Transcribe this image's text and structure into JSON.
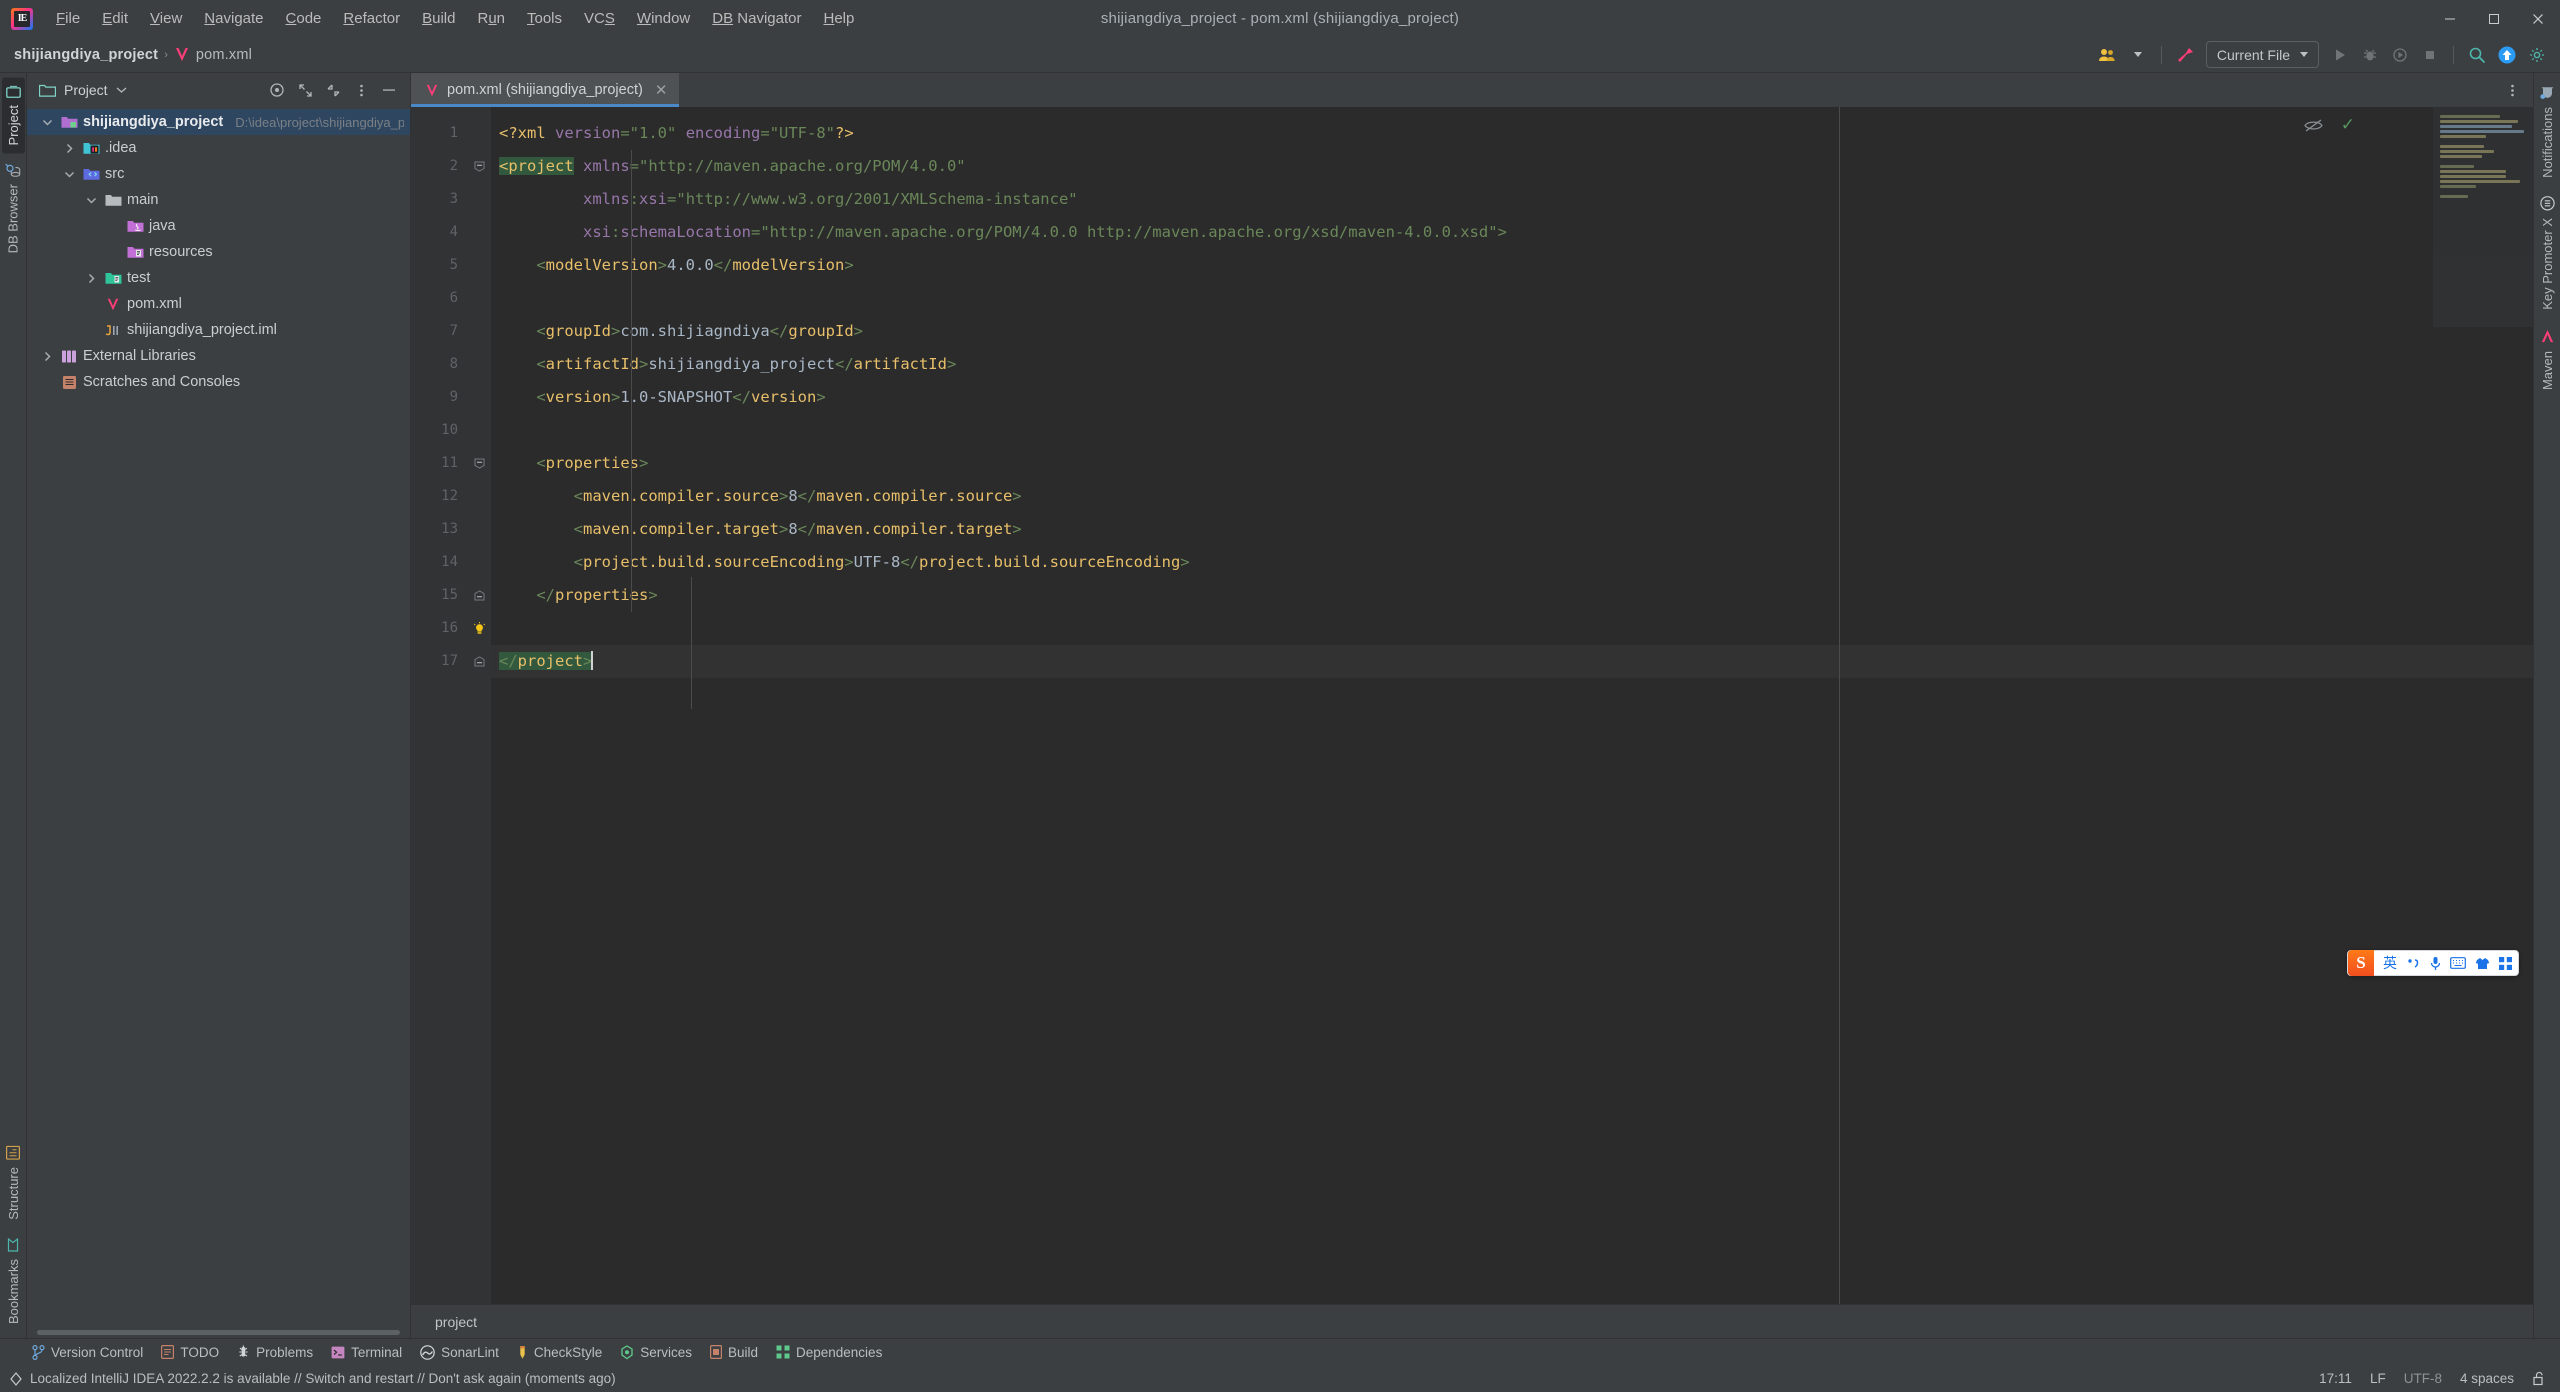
{
  "window": {
    "title": "shijiangdiya_project - pom.xml (shijiangdiya_project)",
    "logo_text": "IE",
    "minimize": "—",
    "maximize": "☐",
    "close": "✕"
  },
  "menu": {
    "items": [
      {
        "pre": "",
        "mn": "F",
        "post": "ile"
      },
      {
        "pre": "",
        "mn": "E",
        "post": "dit"
      },
      {
        "pre": "",
        "mn": "V",
        "post": "iew"
      },
      {
        "pre": "",
        "mn": "N",
        "post": "avigate"
      },
      {
        "pre": "",
        "mn": "C",
        "post": "ode"
      },
      {
        "pre": "",
        "mn": "R",
        "post": "efactor"
      },
      {
        "pre": "",
        "mn": "B",
        "post": "uild"
      },
      {
        "pre": "R",
        "mn": "u",
        "post": "n"
      },
      {
        "pre": "",
        "mn": "T",
        "post": "ools"
      },
      {
        "pre": "VC",
        "mn": "S",
        "post": ""
      },
      {
        "pre": "",
        "mn": "W",
        "post": "indow"
      },
      {
        "pre": "",
        "mn": "DB",
        "post": " Navigator"
      },
      {
        "pre": "",
        "mn": "H",
        "post": "elp"
      }
    ]
  },
  "navbar": {
    "crumbs": [
      "shijiangdiya_project",
      "pom.xml"
    ],
    "separator": "›",
    "run_config": "Current File",
    "icons": [
      "people-icon",
      "hammer-icon",
      "run-icon",
      "debug-icon",
      "run-coverage-icon",
      "stop-icon",
      "search-icon",
      "update-icon",
      "settings-icon"
    ]
  },
  "left_strip": {
    "top": [
      {
        "label": "Project",
        "icon": "project-icon",
        "active": true
      },
      {
        "label": "DB Browser",
        "icon": "db-browser-icon",
        "active": false
      }
    ],
    "bottom": [
      {
        "label": "Structure",
        "icon": "structure-icon"
      },
      {
        "label": "Bookmarks",
        "icon": "bookmarks-icon"
      }
    ]
  },
  "right_strip": {
    "items": [
      {
        "label": "Notifications",
        "icon": "notifications-icon"
      },
      {
        "label": "Key Promoter X",
        "icon": "key-promoter-icon"
      },
      {
        "label": "Maven",
        "icon": "maven-icon"
      }
    ]
  },
  "project_panel": {
    "title": "Project",
    "header_icons": [
      "target-icon",
      "expand-icon",
      "collapse-icon",
      "more-icon",
      "hide-icon"
    ],
    "tree": [
      {
        "indent": 0,
        "arrow": "down",
        "icon": "module-folder",
        "label": "shijiangdiya_project",
        "path": "D:\\idea\\project\\shijiangdiya_project",
        "selected": true,
        "bold": true
      },
      {
        "indent": 1,
        "arrow": "right",
        "icon": "idea-folder",
        "label": ".idea",
        "path": "",
        "selected": false,
        "bold": false
      },
      {
        "indent": 1,
        "arrow": "down",
        "icon": "src-folder",
        "label": "src",
        "path": "",
        "selected": false,
        "bold": false
      },
      {
        "indent": 2,
        "arrow": "down",
        "icon": "plain-folder",
        "label": "main",
        "path": "",
        "selected": false,
        "bold": false
      },
      {
        "indent": 3,
        "arrow": "none",
        "icon": "java-folder",
        "label": "java",
        "path": "",
        "selected": false,
        "bold": false
      },
      {
        "indent": 3,
        "arrow": "none",
        "icon": "resources-folder",
        "label": "resources",
        "path": "",
        "selected": false,
        "bold": false
      },
      {
        "indent": 2,
        "arrow": "right",
        "icon": "test-folder",
        "label": "test",
        "path": "",
        "selected": false,
        "bold": false
      },
      {
        "indent": 2,
        "arrow": "none",
        "icon": "maven-file",
        "label": "pom.xml",
        "path": "",
        "selected": false,
        "bold": false
      },
      {
        "indent": 2,
        "arrow": "none",
        "icon": "iml-file",
        "label": "shijiangdiya_project.iml",
        "path": "",
        "selected": false,
        "bold": false
      },
      {
        "indent": 0,
        "arrow": "right",
        "icon": "libraries-icon",
        "label": "External Libraries",
        "path": "",
        "selected": false,
        "bold": false
      },
      {
        "indent": 0,
        "arrow": "none",
        "icon": "scratches-icon",
        "label": "Scratches and Consoles",
        "path": "",
        "selected": false,
        "bold": false
      }
    ]
  },
  "editor": {
    "tab": {
      "label": "pom.xml (shijiangdiya_project)",
      "icon": "maven-icon",
      "close": "✕"
    },
    "breadcrumb_status": "project",
    "inspection_ok": "✓",
    "reader_mode_icon": "eye-off-icon",
    "lines": [
      {
        "n": 1,
        "fold": "",
        "tokens": [
          {
            "t": "<?xml ",
            "c": "proc"
          },
          {
            "t": "version",
            "c": "attr"
          },
          {
            "t": "=",
            "c": "tagb"
          },
          {
            "t": "\"1.0\"",
            "c": "str"
          },
          {
            "t": " ",
            "c": "txt"
          },
          {
            "t": "encoding",
            "c": "attr"
          },
          {
            "t": "=",
            "c": "tagb"
          },
          {
            "t": "\"UTF-8\"",
            "c": "str"
          },
          {
            "t": "?>",
            "c": "proc"
          }
        ]
      },
      {
        "n": 2,
        "fold": "minus",
        "tokens": [
          {
            "t": "<project",
            "c": "tagn hl"
          },
          {
            "t": " ",
            "c": "txt"
          },
          {
            "t": "xmlns",
            "c": "attr"
          },
          {
            "t": "=",
            "c": "tagb"
          },
          {
            "t": "\"http://maven.apache.org/POM/4.0.0\"",
            "c": "str"
          }
        ]
      },
      {
        "n": 3,
        "fold": "",
        "tokens": [
          {
            "t": "         ",
            "c": "txt"
          },
          {
            "t": "xmlns",
            "c": "attr"
          },
          {
            "t": ":",
            "c": "tagb"
          },
          {
            "t": "xsi",
            "c": "attr"
          },
          {
            "t": "=",
            "c": "tagb"
          },
          {
            "t": "\"http://www.w3.org/2001/XMLSchema-instance\"",
            "c": "str"
          }
        ]
      },
      {
        "n": 4,
        "fold": "",
        "tokens": [
          {
            "t": "         ",
            "c": "txt"
          },
          {
            "t": "xsi",
            "c": "attr"
          },
          {
            "t": ":",
            "c": "tagb"
          },
          {
            "t": "schemaLocation",
            "c": "attr"
          },
          {
            "t": "=",
            "c": "tagb"
          },
          {
            "t": "\"http://maven.apache.org/POM/4.0.0 http://maven.apache.org/xsd/maven-4.0.0.xsd\"",
            "c": "str"
          },
          {
            "t": ">",
            "c": "tagb"
          }
        ]
      },
      {
        "n": 5,
        "fold": "",
        "tokens": [
          {
            "t": "    <",
            "c": "tagb"
          },
          {
            "t": "modelVersion",
            "c": "tagn"
          },
          {
            "t": ">",
            "c": "tagb"
          },
          {
            "t": "4.0.0",
            "c": "txt"
          },
          {
            "t": "</",
            "c": "tagb"
          },
          {
            "t": "modelVersion",
            "c": "tagn"
          },
          {
            "t": ">",
            "c": "tagb"
          }
        ]
      },
      {
        "n": 6,
        "fold": "",
        "tokens": []
      },
      {
        "n": 7,
        "fold": "",
        "tokens": [
          {
            "t": "    <",
            "c": "tagb"
          },
          {
            "t": "groupId",
            "c": "tagn"
          },
          {
            "t": ">",
            "c": "tagb"
          },
          {
            "t": "com.shijiagndiya",
            "c": "txt"
          },
          {
            "t": "</",
            "c": "tagb"
          },
          {
            "t": "groupId",
            "c": "tagn"
          },
          {
            "t": ">",
            "c": "tagb"
          }
        ]
      },
      {
        "n": 8,
        "fold": "",
        "tokens": [
          {
            "t": "    <",
            "c": "tagb"
          },
          {
            "t": "artifactId",
            "c": "tagn"
          },
          {
            "t": ">",
            "c": "tagb"
          },
          {
            "t": "shijiangdiya_project",
            "c": "txt"
          },
          {
            "t": "</",
            "c": "tagb"
          },
          {
            "t": "artifactId",
            "c": "tagn"
          },
          {
            "t": ">",
            "c": "tagb"
          }
        ]
      },
      {
        "n": 9,
        "fold": "",
        "tokens": [
          {
            "t": "    <",
            "c": "tagb"
          },
          {
            "t": "version",
            "c": "tagn"
          },
          {
            "t": ">",
            "c": "tagb"
          },
          {
            "t": "1.0-SNAPSHOT",
            "c": "txt"
          },
          {
            "t": "</",
            "c": "tagb"
          },
          {
            "t": "version",
            "c": "tagn"
          },
          {
            "t": ">",
            "c": "tagb"
          }
        ]
      },
      {
        "n": 10,
        "fold": "",
        "tokens": []
      },
      {
        "n": 11,
        "fold": "minus",
        "tokens": [
          {
            "t": "    <",
            "c": "tagb"
          },
          {
            "t": "properties",
            "c": "tagn"
          },
          {
            "t": ">",
            "c": "tagb"
          }
        ]
      },
      {
        "n": 12,
        "fold": "",
        "tokens": [
          {
            "t": "        <",
            "c": "tagb"
          },
          {
            "t": "maven.compiler.source",
            "c": "tagn"
          },
          {
            "t": ">",
            "c": "tagb"
          },
          {
            "t": "8",
            "c": "txt"
          },
          {
            "t": "</",
            "c": "tagb"
          },
          {
            "t": "maven.compiler.source",
            "c": "tagn"
          },
          {
            "t": ">",
            "c": "tagb"
          }
        ]
      },
      {
        "n": 13,
        "fold": "",
        "tokens": [
          {
            "t": "        <",
            "c": "tagb"
          },
          {
            "t": "maven.compiler.target",
            "c": "tagn"
          },
          {
            "t": ">",
            "c": "tagb"
          },
          {
            "t": "8",
            "c": "txt"
          },
          {
            "t": "</",
            "c": "tagb"
          },
          {
            "t": "maven.compiler.target",
            "c": "tagn"
          },
          {
            "t": ">",
            "c": "tagb"
          }
        ]
      },
      {
        "n": 14,
        "fold": "",
        "tokens": [
          {
            "t": "        <",
            "c": "tagb"
          },
          {
            "t": "project.build.sourceEncoding",
            "c": "tagn"
          },
          {
            "t": ">",
            "c": "tagb"
          },
          {
            "t": "UTF-8",
            "c": "txt"
          },
          {
            "t": "</",
            "c": "tagb"
          },
          {
            "t": "project.build.sourceEncoding",
            "c": "tagn"
          },
          {
            "t": ">",
            "c": "tagb"
          }
        ]
      },
      {
        "n": 15,
        "fold": "end",
        "tokens": [
          {
            "t": "    </",
            "c": "tagb"
          },
          {
            "t": "properties",
            "c": "tagn"
          },
          {
            "t": ">",
            "c": "tagb"
          }
        ]
      },
      {
        "n": 16,
        "fold": "bulb",
        "tokens": []
      },
      {
        "n": 17,
        "fold": "end",
        "tokens": [
          {
            "t": "</",
            "c": "tagb hl"
          },
          {
            "t": "project",
            "c": "tagn hl"
          },
          {
            "t": ">",
            "c": "tagb hl"
          }
        ],
        "current": true,
        "caret": true
      }
    ]
  },
  "bottom_bar": {
    "items": [
      {
        "label": "Version Control",
        "icon": "vcs-icon"
      },
      {
        "label": "TODO",
        "icon": "todo-icon"
      },
      {
        "label": "Problems",
        "icon": "problems-icon"
      },
      {
        "label": "Terminal",
        "icon": "terminal-icon"
      },
      {
        "label": "SonarLint",
        "icon": "sonarlint-icon"
      },
      {
        "label": "CheckStyle",
        "icon": "checkstyle-icon"
      },
      {
        "label": "Services",
        "icon": "services-icon"
      },
      {
        "label": "Build",
        "icon": "build-icon"
      },
      {
        "label": "Dependencies",
        "icon": "dependencies-icon"
      }
    ]
  },
  "status_bar": {
    "message": "Localized IntelliJ IDEA 2022.2.2 is available // Switch and restart // Don't ask again (moments ago)",
    "caret_position": "17:11",
    "line_separator": "LF",
    "encoding": "UTF-8",
    "indent": "4 spaces",
    "lock_icon": "unlocked-icon"
  },
  "ime": {
    "logo": "S",
    "mode": "英",
    "items": [
      "punctuation-icon",
      "microphone-icon",
      "keyboard-icon",
      "skin-icon",
      "apps-icon"
    ]
  },
  "colors": {
    "accent_blue": "#4a88c7",
    "maven_pink": "#ff3d78",
    "tag_name": "#e8bf6a",
    "string_green": "#6a8759",
    "attr_purple": "#9876aa",
    "text_blue": "#a9b7c6",
    "selection": "#2f4661",
    "editor_bg": "#2b2b2b",
    "panel_bg": "#3c3f41"
  }
}
